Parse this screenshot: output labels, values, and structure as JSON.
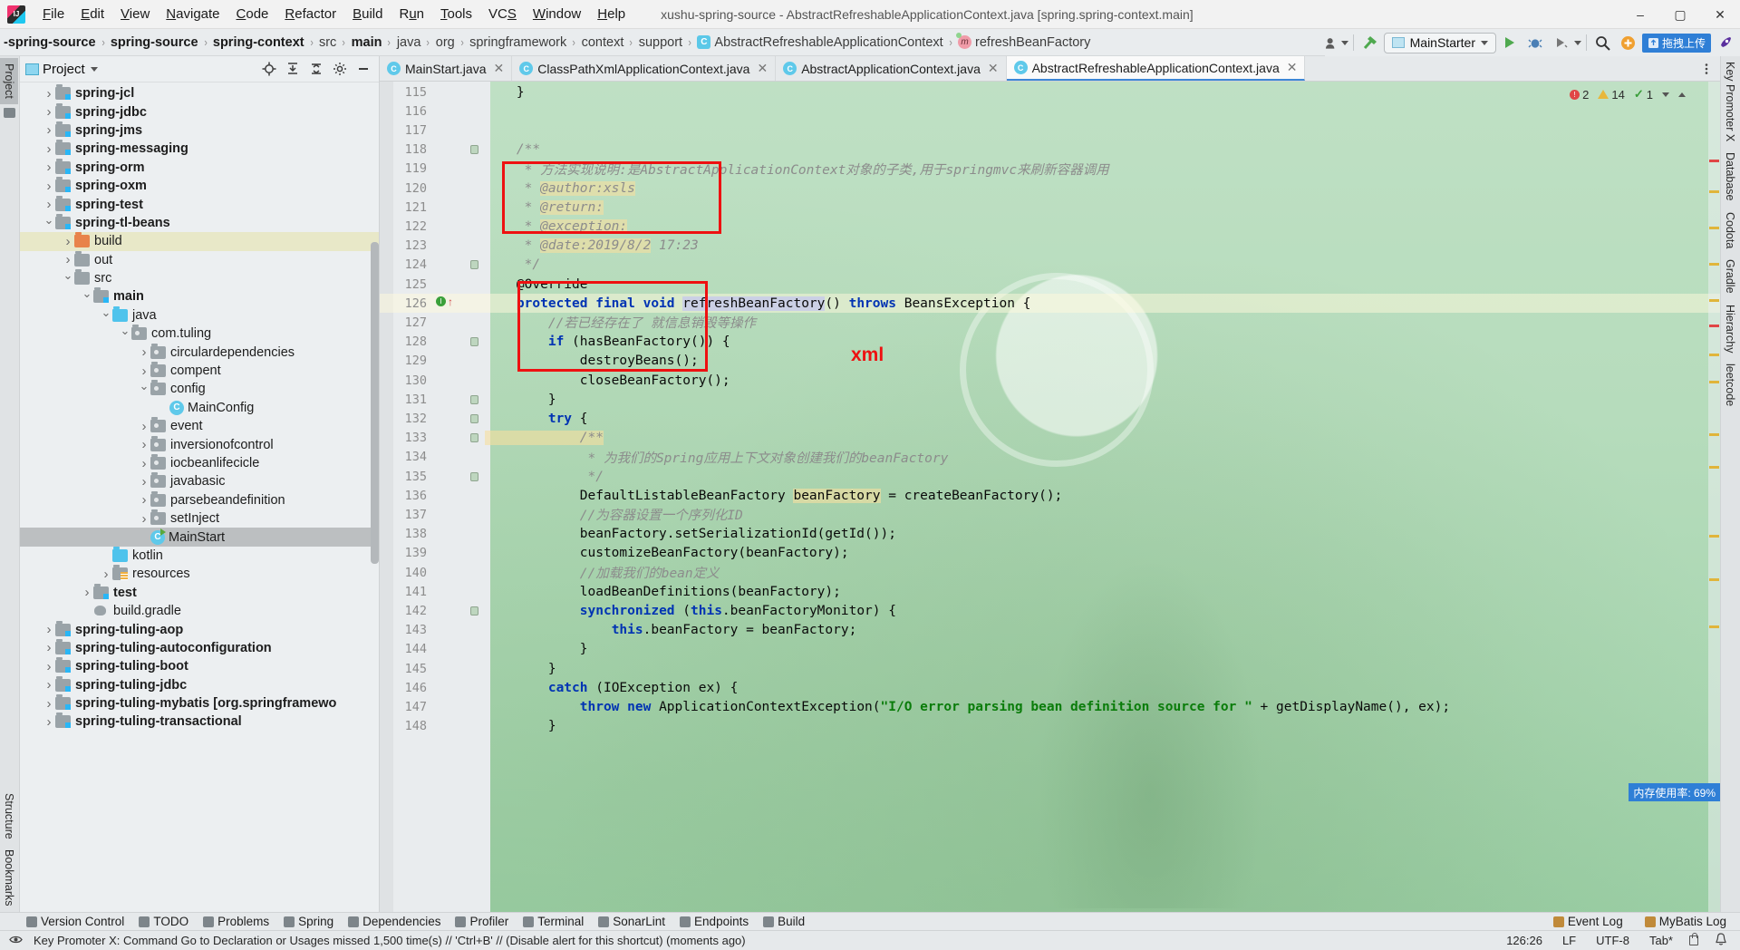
{
  "titlebar": {
    "logo_icon": "intellij-logo-icon",
    "menus": [
      "File",
      "Edit",
      "View",
      "Navigate",
      "Code",
      "Refactor",
      "Build",
      "Run",
      "Tools",
      "VCS",
      "Window",
      "Help"
    ],
    "window_title": "xushu-spring-source - AbstractRefreshableApplicationContext.java [spring.spring-context.main]",
    "minimize": "–",
    "maximize": "▢",
    "close": "✕"
  },
  "navbar": {
    "crumbs": [
      {
        "label": "-spring-source",
        "bold": true,
        "icon": null
      },
      {
        "label": "spring-source",
        "bold": true,
        "icon": null
      },
      {
        "label": "spring-context",
        "bold": true,
        "icon": null
      },
      {
        "label": "src",
        "bold": false,
        "icon": null
      },
      {
        "label": "main",
        "bold": true,
        "icon": null
      },
      {
        "label": "java",
        "bold": false,
        "icon": null
      },
      {
        "label": "org",
        "bold": false,
        "icon": null
      },
      {
        "label": "springframework",
        "bold": false,
        "icon": null
      },
      {
        "label": "context",
        "bold": false,
        "icon": null
      },
      {
        "label": "support",
        "bold": false,
        "icon": null
      },
      {
        "label": "AbstractRefreshableApplicationContext",
        "bold": false,
        "icon": "class-icon"
      },
      {
        "label": "refreshBeanFactory",
        "bold": false,
        "icon": "method-icon"
      }
    ],
    "separator": "›",
    "right": {
      "user_icon": "user-avatar-icon",
      "build_icon": "hammer-icon",
      "run_config": "MainStarter",
      "run_icon": "run-play-icon",
      "debug_icon": "debug-bug-icon",
      "coverage_icon": "coverage-run-icon",
      "search_icon": "search-icon",
      "plugin_icon": "plugin-add-icon",
      "upload_label": "拖拽上传",
      "upload_icon": "upload-drag-icon",
      "rocket_icon": "rocket-icon"
    }
  },
  "left_strip": {
    "top_tabs": [
      {
        "label": "Project",
        "icon": "project-folder-icon",
        "active": true
      }
    ],
    "bottom_tabs": [
      {
        "label": "Structure",
        "icon": "structure-icon"
      },
      {
        "label": "Bookmarks",
        "icon": "bookmark-icon"
      }
    ]
  },
  "right_strip": {
    "tabs": [
      {
        "label": "Key Promoter X",
        "icon": "key-promoter-icon"
      },
      {
        "label": "Database",
        "icon": "database-icon"
      },
      {
        "label": "Codota",
        "icon": "codota-icon"
      },
      {
        "label": "Gradle",
        "icon": "gradle-elephant-icon"
      },
      {
        "label": "Hierarchy",
        "icon": "hierarchy-icon"
      },
      {
        "label": "leetcode",
        "icon": "leetcode-icon"
      }
    ]
  },
  "project_panel": {
    "title": "Project",
    "title_icon": "project-window-icon",
    "dropdown_icon": "chevron-down-icon",
    "toolbar_icons": [
      "locate-target-icon",
      "expand-all-icon",
      "collapse-all-icon",
      "settings-gear-icon",
      "hide-minimize-icon"
    ],
    "tree": [
      {
        "label": "spring-jcl",
        "depth": 1,
        "arrow": "closed",
        "icon": "mod",
        "bold": true,
        "state": "normal"
      },
      {
        "label": "spring-jdbc",
        "depth": 1,
        "arrow": "closed",
        "icon": "mod",
        "bold": true,
        "state": "normal"
      },
      {
        "label": "spring-jms",
        "depth": 1,
        "arrow": "closed",
        "icon": "mod",
        "bold": true,
        "state": "normal"
      },
      {
        "label": "spring-messaging",
        "depth": 1,
        "arrow": "closed",
        "icon": "mod",
        "bold": true,
        "state": "normal"
      },
      {
        "label": "spring-orm",
        "depth": 1,
        "arrow": "closed",
        "icon": "mod",
        "bold": true,
        "state": "normal"
      },
      {
        "label": "spring-oxm",
        "depth": 1,
        "arrow": "closed",
        "icon": "mod",
        "bold": true,
        "state": "normal"
      },
      {
        "label": "spring-test",
        "depth": 1,
        "arrow": "closed",
        "icon": "mod",
        "bold": true,
        "state": "normal"
      },
      {
        "label": "spring-tl-beans",
        "depth": 1,
        "arrow": "open",
        "icon": "mod",
        "bold": true,
        "state": "normal"
      },
      {
        "label": "build",
        "depth": 2,
        "arrow": "closed",
        "icon": "excl",
        "bold": false,
        "state": "highlight"
      },
      {
        "label": "out",
        "depth": 2,
        "arrow": "closed",
        "icon": "plain",
        "bold": false,
        "state": "normal"
      },
      {
        "label": "src",
        "depth": 2,
        "arrow": "open",
        "icon": "plain",
        "bold": false,
        "state": "normal"
      },
      {
        "label": "main",
        "depth": 3,
        "arrow": "open",
        "icon": "mod",
        "bold": true,
        "state": "normal"
      },
      {
        "label": "java",
        "depth": 4,
        "arrow": "open",
        "icon": "src",
        "bold": false,
        "state": "normal"
      },
      {
        "label": "com.tuling",
        "depth": 5,
        "arrow": "open",
        "icon": "pkg",
        "bold": false,
        "state": "normal"
      },
      {
        "label": "circulardependencies",
        "depth": 6,
        "arrow": "closed",
        "icon": "pkg",
        "bold": false,
        "state": "normal"
      },
      {
        "label": "compent",
        "depth": 6,
        "arrow": "closed",
        "icon": "pkg",
        "bold": false,
        "state": "normal"
      },
      {
        "label": "config",
        "depth": 6,
        "arrow": "open",
        "icon": "pkg",
        "bold": false,
        "state": "normal"
      },
      {
        "label": "MainConfig",
        "depth": 7,
        "arrow": "none",
        "icon": "cls",
        "bold": false,
        "state": "normal"
      },
      {
        "label": "event",
        "depth": 6,
        "arrow": "closed",
        "icon": "pkg",
        "bold": false,
        "state": "normal"
      },
      {
        "label": "inversionofcontrol",
        "depth": 6,
        "arrow": "closed",
        "icon": "pkg",
        "bold": false,
        "state": "normal"
      },
      {
        "label": "iocbeanlifecicle",
        "depth": 6,
        "arrow": "closed",
        "icon": "pkg",
        "bold": false,
        "state": "normal"
      },
      {
        "label": "javabasic",
        "depth": 6,
        "arrow": "closed",
        "icon": "pkg",
        "bold": false,
        "state": "normal"
      },
      {
        "label": "parsebeandefinition",
        "depth": 6,
        "arrow": "closed",
        "icon": "pkg",
        "bold": false,
        "state": "normal"
      },
      {
        "label": "setInject",
        "depth": 6,
        "arrow": "closed",
        "icon": "pkg",
        "bold": false,
        "state": "normal"
      },
      {
        "label": "MainStart",
        "depth": 6,
        "arrow": "none",
        "icon": "clsrun",
        "bold": false,
        "state": "selected"
      },
      {
        "label": "kotlin",
        "depth": 4,
        "arrow": "none",
        "icon": "src",
        "bold": false,
        "state": "normal"
      },
      {
        "label": "resources",
        "depth": 4,
        "arrow": "closed",
        "icon": "res",
        "bold": false,
        "state": "normal"
      },
      {
        "label": "test",
        "depth": 3,
        "arrow": "closed",
        "icon": "mod",
        "bold": true,
        "state": "normal"
      },
      {
        "label": "build.gradle",
        "depth": 3,
        "arrow": "none",
        "icon": "gradle",
        "bold": false,
        "state": "normal"
      },
      {
        "label": "spring-tuling-aop",
        "depth": 1,
        "arrow": "closed",
        "icon": "mod",
        "bold": true,
        "state": "normal"
      },
      {
        "label": "spring-tuling-autoconfiguration",
        "depth": 1,
        "arrow": "closed",
        "icon": "mod",
        "bold": true,
        "state": "normal"
      },
      {
        "label": "spring-tuling-boot",
        "depth": 1,
        "arrow": "closed",
        "icon": "mod",
        "bold": true,
        "state": "normal"
      },
      {
        "label": "spring-tuling-jdbc",
        "depth": 1,
        "arrow": "closed",
        "icon": "mod",
        "bold": true,
        "state": "normal"
      },
      {
        "label": "spring-tuling-mybatis [org.springframewo",
        "depth": 1,
        "arrow": "closed",
        "icon": "mod",
        "bold": true,
        "state": "normal"
      },
      {
        "label": "spring-tuling-transactional",
        "depth": 1,
        "arrow": "closed",
        "icon": "mod",
        "bold": true,
        "state": "normal"
      }
    ]
  },
  "editor": {
    "tabs": [
      {
        "label": "MainStart.java",
        "icon": "java-class-icon",
        "active": false,
        "close": "✕"
      },
      {
        "label": "ClassPathXmlApplicationContext.java",
        "icon": "java-class-icon",
        "active": false,
        "close": "✕"
      },
      {
        "label": "AbstractApplicationContext.java",
        "icon": "java-class-icon",
        "active": false,
        "close": "✕"
      },
      {
        "label": "AbstractRefreshableApplicationContext.java",
        "icon": "java-class-icon",
        "active": true,
        "close": "✕"
      }
    ],
    "tabs_overflow_icon": "more-options-icon",
    "inspection": {
      "error_count": "2",
      "warning_count": "14",
      "ok_count": "1",
      "error_icon": "error-circle-icon",
      "warning_icon": "warning-triangle-icon",
      "ok_icon": "check-icon",
      "chevron_down_icon": "chevron-down-icon",
      "chevron_up_icon": "chevron-up-icon"
    },
    "memory_badge": "内存使用率: 69%",
    "annotation_label": "xml",
    "annotation_color": "#ee1111",
    "first_line": 115,
    "caret_line": 126,
    "lines": [
      {
        "n": 115,
        "segments": [
          {
            "t": "    }",
            "c": "plain"
          }
        ]
      },
      {
        "n": 116,
        "segments": []
      },
      {
        "n": 117,
        "segments": []
      },
      {
        "n": 118,
        "segments": [
          {
            "t": "    /**",
            "c": "cm"
          }
        ]
      },
      {
        "n": 119,
        "segments": [
          {
            "t": "     * 方法实现说明:是AbstractApplicationContext对象的子类,用于springmvc来刷新容器调用",
            "c": "cm"
          }
        ]
      },
      {
        "n": 120,
        "segments": [
          {
            "t": "     * ",
            "c": "cm"
          },
          {
            "t": "@author:xsls",
            "c": "cm-hl"
          }
        ]
      },
      {
        "n": 121,
        "segments": [
          {
            "t": "     * ",
            "c": "cm"
          },
          {
            "t": "@return:",
            "c": "cm-hl"
          }
        ]
      },
      {
        "n": 122,
        "segments": [
          {
            "t": "     * ",
            "c": "cm"
          },
          {
            "t": "@exception:",
            "c": "cm-hl"
          }
        ]
      },
      {
        "n": 123,
        "segments": [
          {
            "t": "     * ",
            "c": "cm"
          },
          {
            "t": "@date:2019/8/2",
            "c": "cm-hl"
          },
          {
            "t": " 17:23",
            "c": "cm"
          }
        ]
      },
      {
        "n": 124,
        "segments": [
          {
            "t": "     */",
            "c": "cm"
          }
        ]
      },
      {
        "n": 125,
        "segments": [
          {
            "t": "    @Override",
            "c": "plain"
          }
        ]
      },
      {
        "n": 126,
        "segments": [
          {
            "t": "    ",
            "c": "plain"
          },
          {
            "t": "protected final void ",
            "c": "k"
          },
          {
            "t": "refreshBeanFactory",
            "c": "hl-b"
          },
          {
            "t": "() ",
            "c": "plain"
          },
          {
            "t": "throws",
            "c": "k"
          },
          {
            "t": " BeansException {",
            "c": "plain"
          }
        ]
      },
      {
        "n": 127,
        "segments": [
          {
            "t": "        //若已经存在了 就信息销毁等操作",
            "c": "cm"
          }
        ]
      },
      {
        "n": 128,
        "segments": [
          {
            "t": "        ",
            "c": "plain"
          },
          {
            "t": "if",
            "c": "k"
          },
          {
            "t": " (hasBeanFactory()) {",
            "c": "plain"
          }
        ]
      },
      {
        "n": 129,
        "segments": [
          {
            "t": "            destroyBeans();",
            "c": "plain"
          }
        ]
      },
      {
        "n": 130,
        "segments": [
          {
            "t": "            closeBeanFactory();",
            "c": "plain"
          }
        ]
      },
      {
        "n": 131,
        "segments": [
          {
            "t": "        }",
            "c": "plain"
          }
        ]
      },
      {
        "n": 132,
        "segments": [
          {
            "t": "        ",
            "c": "plain"
          },
          {
            "t": "try",
            "c": "k"
          },
          {
            "t": " {",
            "c": "plain"
          }
        ]
      },
      {
        "n": 133,
        "segments": [
          {
            "t": "            /**",
            "c": "cm-hl"
          }
        ]
      },
      {
        "n": 134,
        "segments": [
          {
            "t": "             * 为我们的Spring应用上下文对象创建我们的beanFactory",
            "c": "cm"
          }
        ]
      },
      {
        "n": 135,
        "segments": [
          {
            "t": "             */",
            "c": "cm"
          }
        ]
      },
      {
        "n": 136,
        "segments": [
          {
            "t": "            DefaultListableBeanFactory ",
            "c": "plain"
          },
          {
            "t": "beanFactory",
            "c": "hl-a"
          },
          {
            "t": " = createBeanFactory();",
            "c": "plain"
          }
        ]
      },
      {
        "n": 137,
        "segments": [
          {
            "t": "            //为容器设置一个序列化ID",
            "c": "cm"
          }
        ]
      },
      {
        "n": 138,
        "segments": [
          {
            "t": "            beanFactory.setSerializationId(getId());",
            "c": "plain"
          }
        ]
      },
      {
        "n": 139,
        "segments": [
          {
            "t": "            customizeBeanFactory(beanFactory);",
            "c": "plain"
          }
        ]
      },
      {
        "n": 140,
        "segments": [
          {
            "t": "            //加载我们的bean定义",
            "c": "cm"
          }
        ]
      },
      {
        "n": 141,
        "segments": [
          {
            "t": "            loadBeanDefinitions(beanFactory);",
            "c": "plain"
          }
        ]
      },
      {
        "n": 142,
        "segments": [
          {
            "t": "            ",
            "c": "plain"
          },
          {
            "t": "synchronized",
            "c": "k"
          },
          {
            "t": " (",
            "c": "plain"
          },
          {
            "t": "this",
            "c": "k"
          },
          {
            "t": ".beanFactoryMonitor) {",
            "c": "plain"
          }
        ]
      },
      {
        "n": 143,
        "segments": [
          {
            "t": "                ",
            "c": "plain"
          },
          {
            "t": "this",
            "c": "k"
          },
          {
            "t": ".beanFactory = beanFactory;",
            "c": "plain"
          }
        ]
      },
      {
        "n": 144,
        "segments": [
          {
            "t": "            }",
            "c": "plain"
          }
        ]
      },
      {
        "n": 145,
        "segments": [
          {
            "t": "        }",
            "c": "plain"
          }
        ]
      },
      {
        "n": 146,
        "segments": [
          {
            "t": "        ",
            "c": "plain"
          },
          {
            "t": "catch",
            "c": "k"
          },
          {
            "t": " (IOException ex) {",
            "c": "plain"
          }
        ]
      },
      {
        "n": 147,
        "segments": [
          {
            "t": "            ",
            "c": "plain"
          },
          {
            "t": "throw new",
            "c": "k"
          },
          {
            "t": " ApplicationContextException(",
            "c": "plain"
          },
          {
            "t": "\"I/O error parsing bean definition source for \"",
            "c": "str"
          },
          {
            "t": " + getDisplayName(), ex);",
            "c": "plain"
          }
        ]
      },
      {
        "n": 148,
        "segments": [
          {
            "t": "        }",
            "c": "plain"
          }
        ]
      }
    ]
  },
  "bottom_bar": {
    "buttons": [
      {
        "label": "Version Control",
        "icon": "version-control-icon"
      },
      {
        "label": "TODO",
        "icon": "todo-list-icon"
      },
      {
        "label": "Problems",
        "icon": "problems-warning-icon"
      },
      {
        "label": "Spring",
        "icon": "spring-leaf-icon"
      },
      {
        "label": "Dependencies",
        "icon": "dependencies-icon"
      },
      {
        "label": "Profiler",
        "icon": "profiler-icon"
      },
      {
        "label": "Terminal",
        "icon": "terminal-icon"
      },
      {
        "label": "SonarLint",
        "icon": "sonarlint-icon"
      },
      {
        "label": "Endpoints",
        "icon": "endpoints-icon"
      },
      {
        "label": "Build",
        "icon": "build-hammer-icon"
      }
    ],
    "right_buttons": [
      {
        "label": "Event Log",
        "icon": "event-log-icon"
      },
      {
        "label": "MyBatis Log",
        "icon": "mybatis-log-icon"
      }
    ]
  },
  "status_bar": {
    "message": "Key Promoter X: Command Go to Declaration or Usages missed 1,500 time(s) // 'Ctrl+B' // (Disable alert for this shortcut) (moments ago)",
    "caret_position": "126:26",
    "line_separator": "LF",
    "encoding": "UTF-8",
    "indent": "Tab*",
    "lock_icon": "read-only-lock-icon",
    "inspection_icon": "inspection-eye-icon",
    "notification_icon": "notification-bell-icon"
  }
}
